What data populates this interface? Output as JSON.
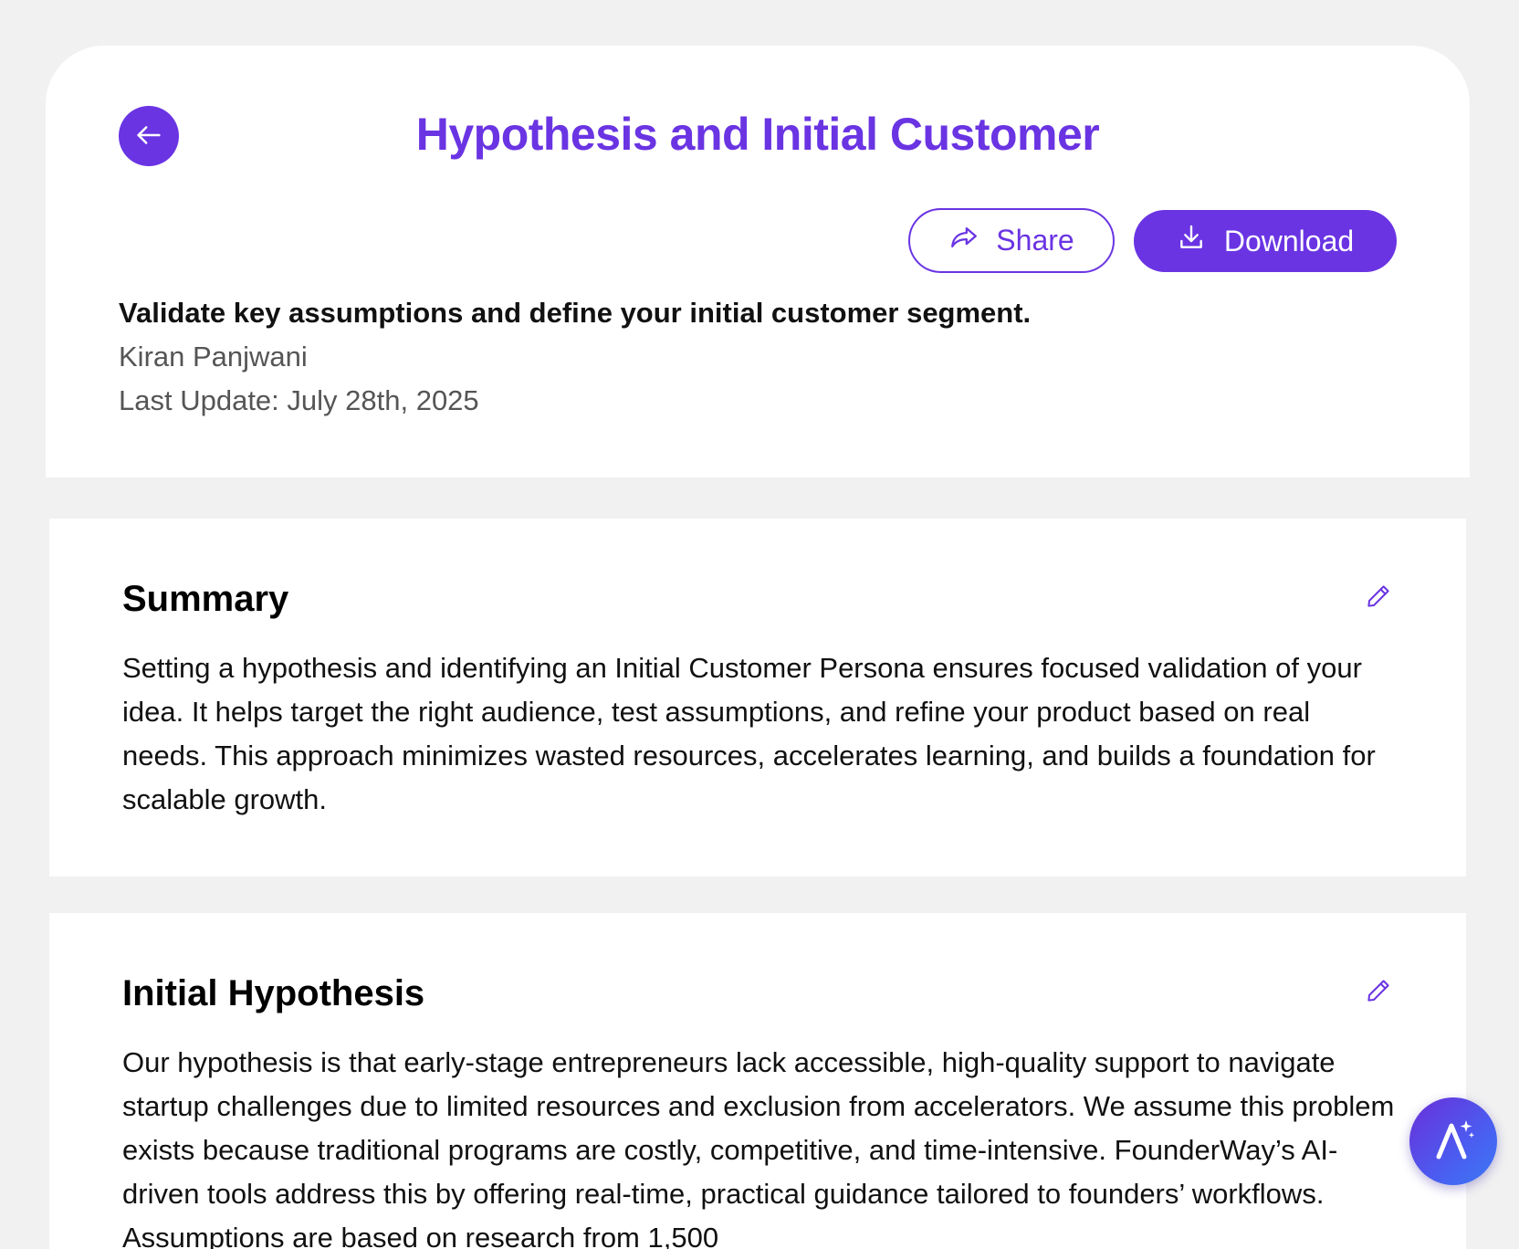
{
  "header": {
    "title": "Hypothesis and Initial Customer",
    "back_icon": "arrow-left-icon",
    "share_label": "Share",
    "share_icon": "share-arrow-icon",
    "download_label": "Download",
    "download_icon": "download-icon",
    "tagline": "Validate key assumptions and define your initial customer segment.",
    "author": "Kiran Panjwani",
    "last_update": "Last Update: July 28th, 2025"
  },
  "sections": {
    "summary": {
      "title": "Summary",
      "edit_icon": "pencil-icon",
      "body": "Setting a hypothesis and identifying an Initial Customer Persona ensures focused validation of your idea. It helps target the right audience, test assumptions, and refine your product based on real needs. This approach minimizes wasted resources, accelerates learning, and builds a foundation for scalable growth."
    },
    "initial_hypothesis": {
      "title": "Initial Hypothesis",
      "edit_icon": "pencil-icon",
      "body": "Our hypothesis is that early-stage entrepreneurs lack accessible, high-quality support to navigate startup challenges due to limited resources and exclusion from accelerators. We assume this problem exists because traditional programs are costly, competitive, and time-intensive. FounderWay’s AI-driven tools address this by offering real-time, practical guidance tailored to founders’ workflows. Assumptions are based on research from 1,500"
    }
  },
  "ai_assistant": {
    "icon": "ai-sparkle-icon"
  },
  "colors": {
    "brand": "#6a34e3",
    "background": "#f1f1f1",
    "card": "#ffffff",
    "muted_text": "#555555"
  }
}
